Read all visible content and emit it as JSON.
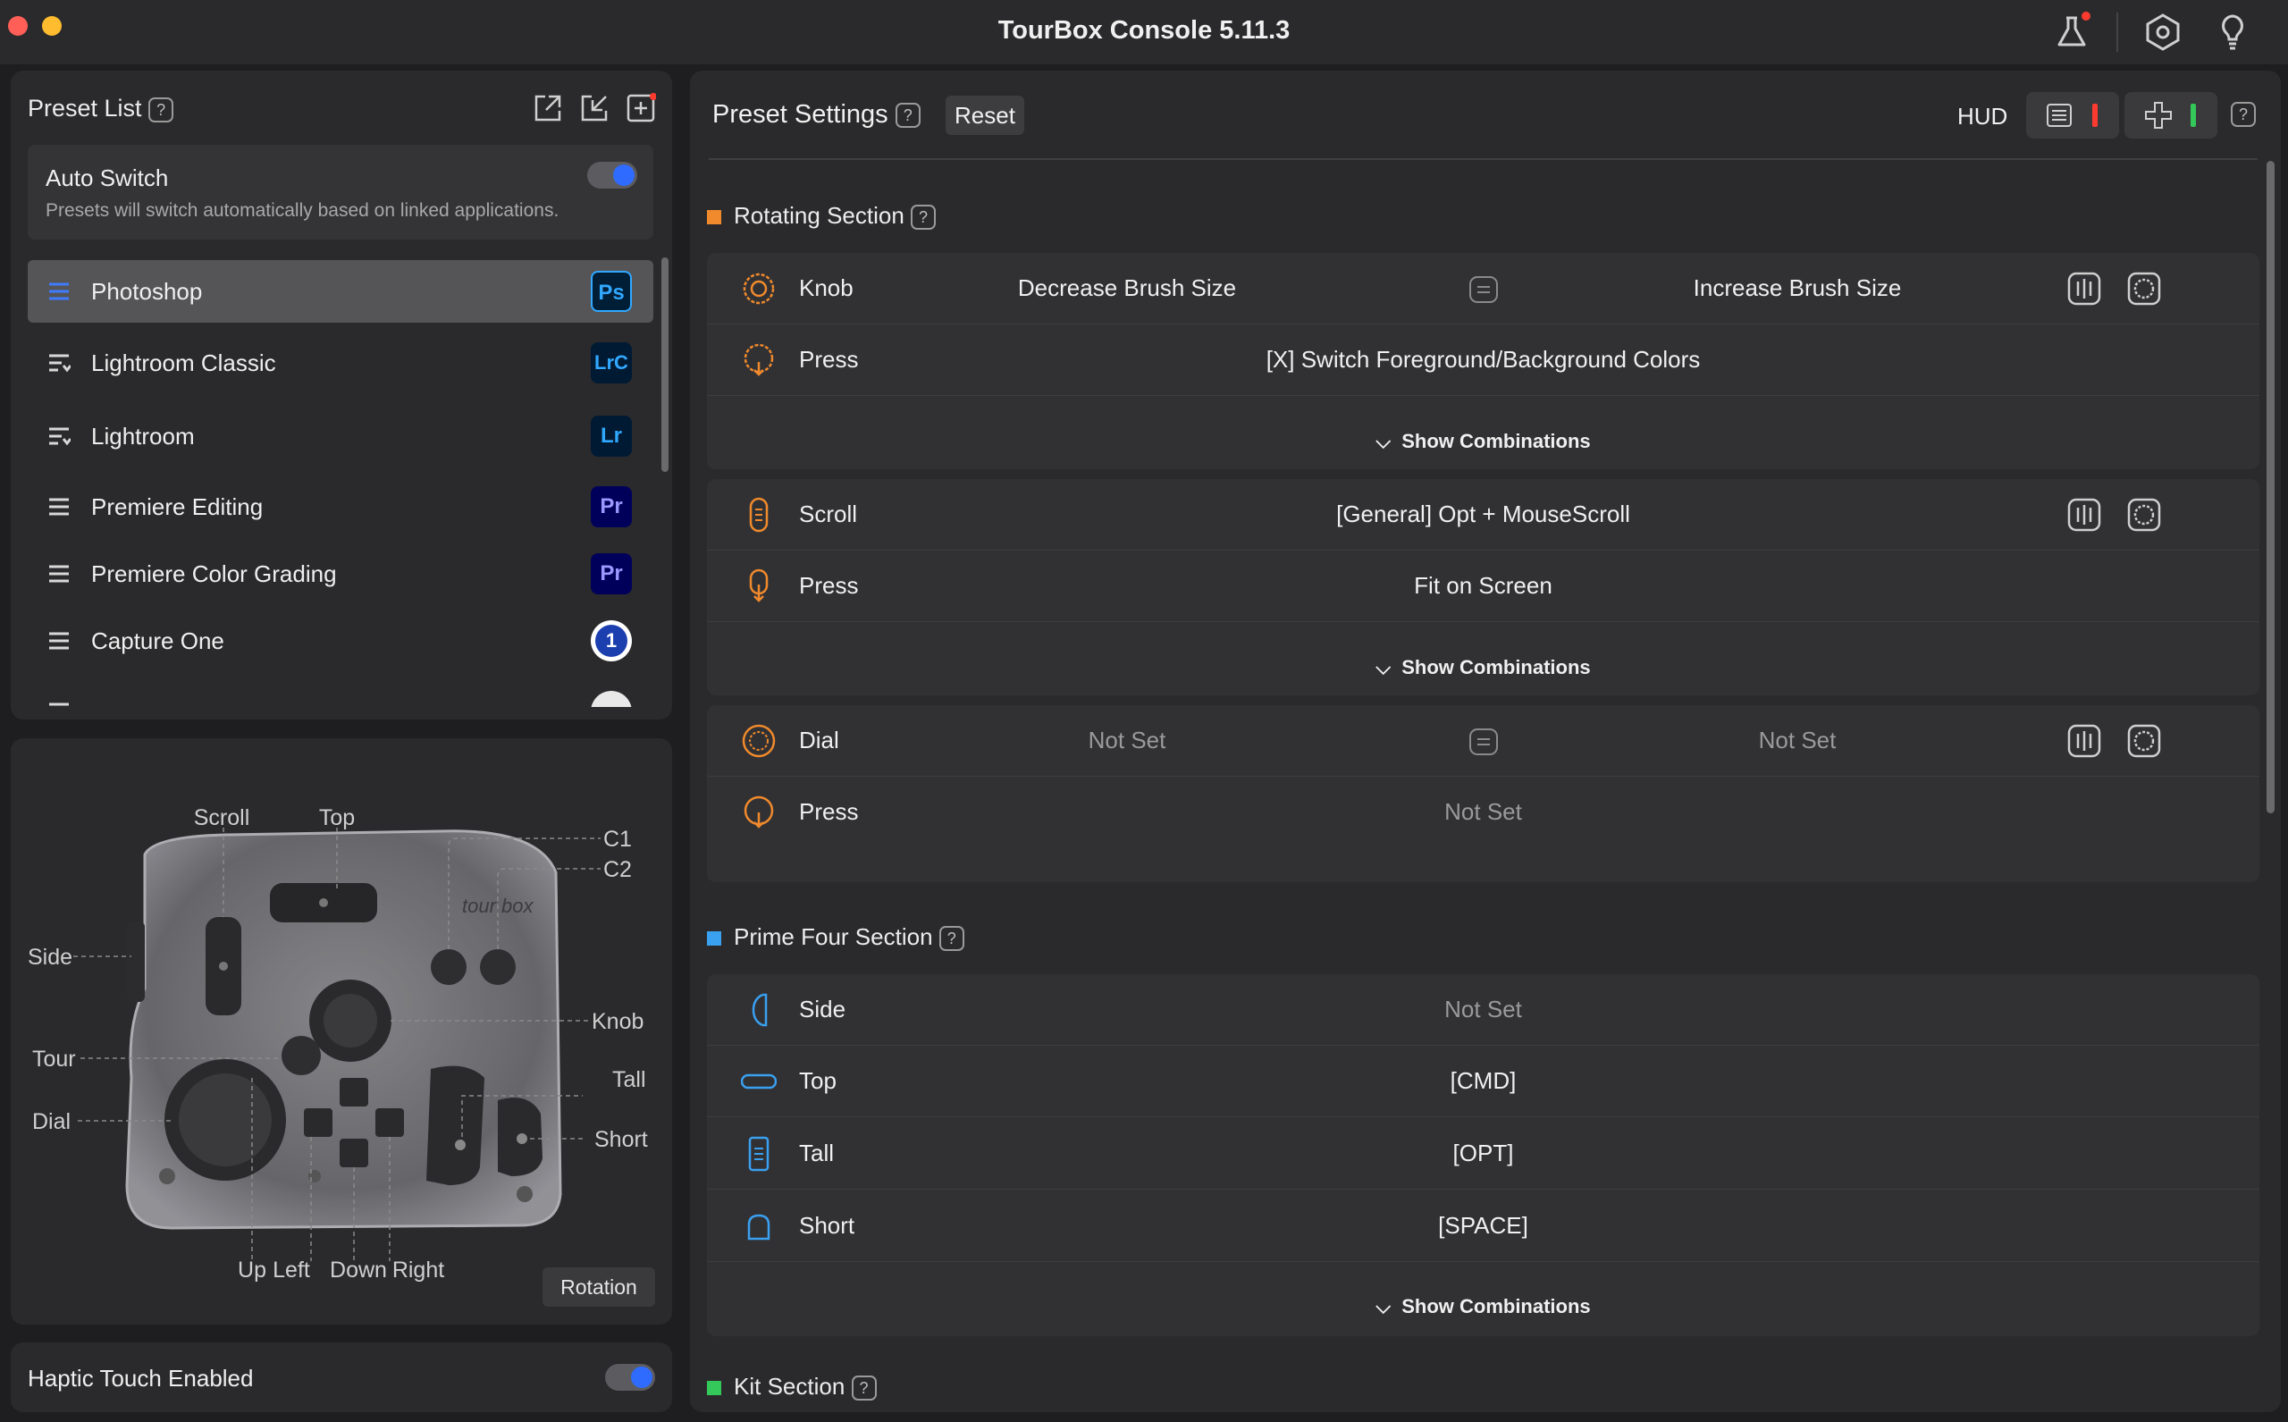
{
  "window": {
    "title": "TourBox Console 5.11.3"
  },
  "colors": {
    "accent": "#2f6bff",
    "orange": "#f08a2c",
    "blue": "#3aa0f0",
    "green": "#34c759",
    "red": "#ff3b30"
  },
  "preset_list": {
    "title": "Preset List",
    "auto_switch": {
      "label": "Auto Switch",
      "description": "Presets will switch automatically based on linked applications."
    },
    "items": [
      {
        "label": "Photoshop",
        "badge": "Ps"
      },
      {
        "label": "Lightroom Classic",
        "badge": "LrC"
      },
      {
        "label": "Lightroom",
        "badge": "Lr"
      },
      {
        "label": "Premiere Editing",
        "badge": "Pr"
      },
      {
        "label": "Premiere Color Grading",
        "badge": "Pr"
      },
      {
        "label": "Capture One",
        "badge": "1"
      }
    ]
  },
  "device": {
    "labels": {
      "scroll": "Scroll",
      "top": "Top",
      "c1": "C1",
      "c2": "C2",
      "side": "Side",
      "knob": "Knob",
      "tour": "Tour",
      "tall": "Tall",
      "dial": "Dial",
      "short": "Short",
      "up": "Up",
      "left": "Left",
      "down": "Down",
      "right": "Right"
    },
    "logo": "tour box",
    "rotation_button": "Rotation"
  },
  "haptic": {
    "label": "Haptic Touch Enabled"
  },
  "settings": {
    "title": "Preset Settings",
    "reset": "Reset",
    "hud": "HUD",
    "show_combinations": "Show Combinations",
    "rotating": {
      "title": "Rotating Section",
      "knob": {
        "name": "Knob",
        "left": "Decrease Brush Size",
        "right": "Increase Brush Size"
      },
      "knob_press": {
        "name": "Press",
        "value": "[X] Switch Foreground/Background Colors"
      },
      "scroll": {
        "name": "Scroll",
        "value": "[General] Opt + MouseScroll"
      },
      "scroll_press": {
        "name": "Press",
        "value": "Fit on Screen"
      },
      "dial": {
        "name": "Dial",
        "left": "Not Set",
        "right": "Not Set"
      },
      "dial_press": {
        "name": "Press",
        "value": "Not Set"
      }
    },
    "prime": {
      "title": "Prime Four Section",
      "side": {
        "name": "Side",
        "value": "Not Set"
      },
      "top": {
        "name": "Top",
        "value": "[CMD]"
      },
      "tall": {
        "name": "Tall",
        "value": "[OPT]"
      },
      "short": {
        "name": "Short",
        "value": "[SPACE]"
      }
    },
    "kit": {
      "title": "Kit Section"
    }
  }
}
